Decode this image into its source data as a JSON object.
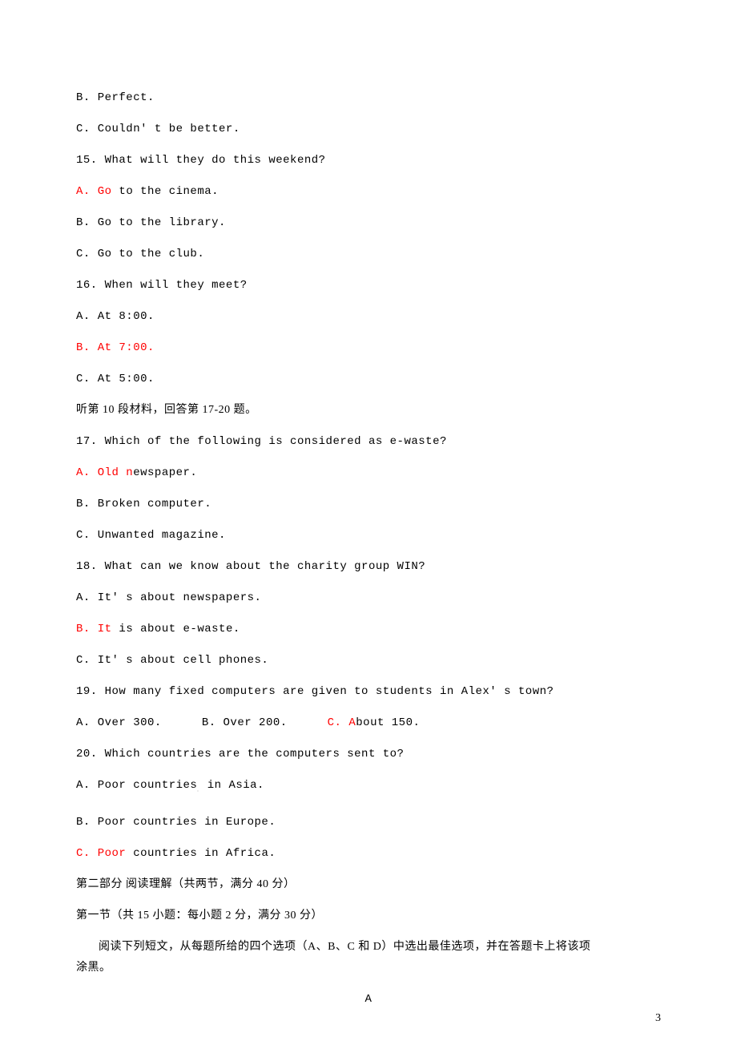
{
  "lines": {
    "l1": "B. Perfect.",
    "l2": "C. Couldn' t be better.",
    "q15": "15. What will they do this weekend?",
    "q15a_red": "A. Go",
    "q15a_rest": " to the cinema.",
    "q15b": "B. Go to the library.",
    "q15c": "C. Go to the club.",
    "q16": "16. When will they meet?",
    "q16a": "A. At 8:00.",
    "q16b_red": "B. At 7:00.",
    "q16c": "C. At 5:00.",
    "sec10": "听第 10 段材料，回答第 17-20 题。",
    "q17": "17. Which of the following is considered as e-waste?",
    "q17a_red": "A. Old n",
    "q17a_rest": "ewspaper.",
    "q17b": "B. Broken computer.",
    "q17c": "C. Unwanted magazine.",
    "q18": "18. What can we know about the charity group WIN?",
    "q18a": "A. It' s about newspapers.",
    "q18b_red": "B. It",
    "q18b_rest": " is about e-waste.",
    "q18c": "C. It' s about cell phones.",
    "q19": "19. How many fixed computers are given to students in Alex' s town?",
    "q19a": "A. Over 300.",
    "q19b": "B. Over 200.",
    "q19c_red": "C. A",
    "q19c_rest": "bout 150.",
    "q20": "20. Which countries are the computers sent to?",
    "q20a_pre": "A. Poor countries",
    "q20a_post": " in Asia.",
    "q20b": "B. Poor countries  in Europe.",
    "q20c_red": "C. Poor",
    "q20c_rest": " countries in Africa.",
    "part2": "第二部分 阅读理解（共两节，满分 40 分）",
    "sec1": "第一节（共 15 小题：每小题 2 分，满分 30 分）",
    "instr": "阅读下列短文，从每题所给的四个选项（A、B、C 和 D）中选出最佳选项，并在答题卡上将该项",
    "instr2": "涂黑。",
    "letterA": "A",
    "pageNum": "3"
  }
}
